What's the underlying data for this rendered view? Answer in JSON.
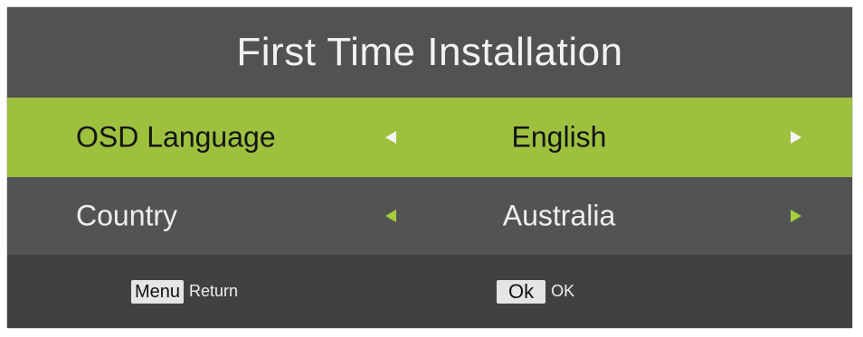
{
  "title": "First Time Installation",
  "rows": [
    {
      "label": "OSD Language",
      "value": "English",
      "selected": true
    },
    {
      "label": "Country",
      "value": "Australia",
      "selected": false
    }
  ],
  "footer": {
    "menu_key": "Menu",
    "menu_action": "Return",
    "ok_key": "Ok",
    "ok_action": "OK"
  },
  "colors": {
    "panel": "#3f4240",
    "title_bar": "#505352",
    "selected_row": "#9dc13f",
    "normal_row": "#515453",
    "accent_arrow": "#a7cf3a"
  },
  "icons": {
    "left": "triangle-left-icon",
    "right": "triangle-right-icon"
  }
}
